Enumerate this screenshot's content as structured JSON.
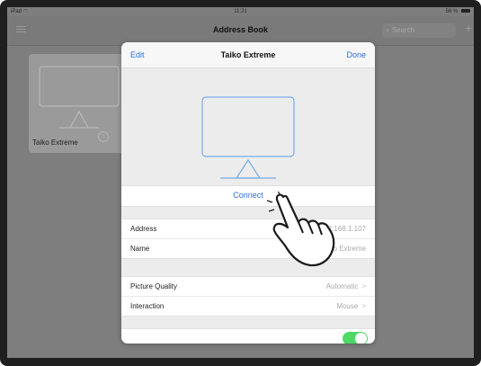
{
  "status_bar": {
    "device": "iPad",
    "time": "11:21",
    "battery": "56 %"
  },
  "navbar": {
    "title": "Address Book",
    "search_placeholder": "Search"
  },
  "card": {
    "name": "Taiko Extreme"
  },
  "modal": {
    "edit_label": "Edit",
    "title": "Taiko Extreme",
    "done_label": "Done",
    "connect_label": "Connect",
    "fields": [
      {
        "label": "Address",
        "value": "192.168.1.107"
      },
      {
        "label": "Name",
        "value": "Taiko Extreme"
      }
    ],
    "settings": [
      {
        "label": "Picture Quality",
        "value": "Automatic"
      },
      {
        "label": "Interaction",
        "value": "Mouse"
      }
    ],
    "partial_row": {
      "label": "",
      "toggle_on": true
    }
  },
  "colors": {
    "accent": "#2c6fe0",
    "toggle_on": "#4cd964"
  },
  "icons": [
    "wifi-icon",
    "battery-icon",
    "menu-icon",
    "search-icon",
    "plus-icon",
    "monitor-icon",
    "info-icon",
    "chevron-right-icon",
    "hand-pointer-icon"
  ]
}
